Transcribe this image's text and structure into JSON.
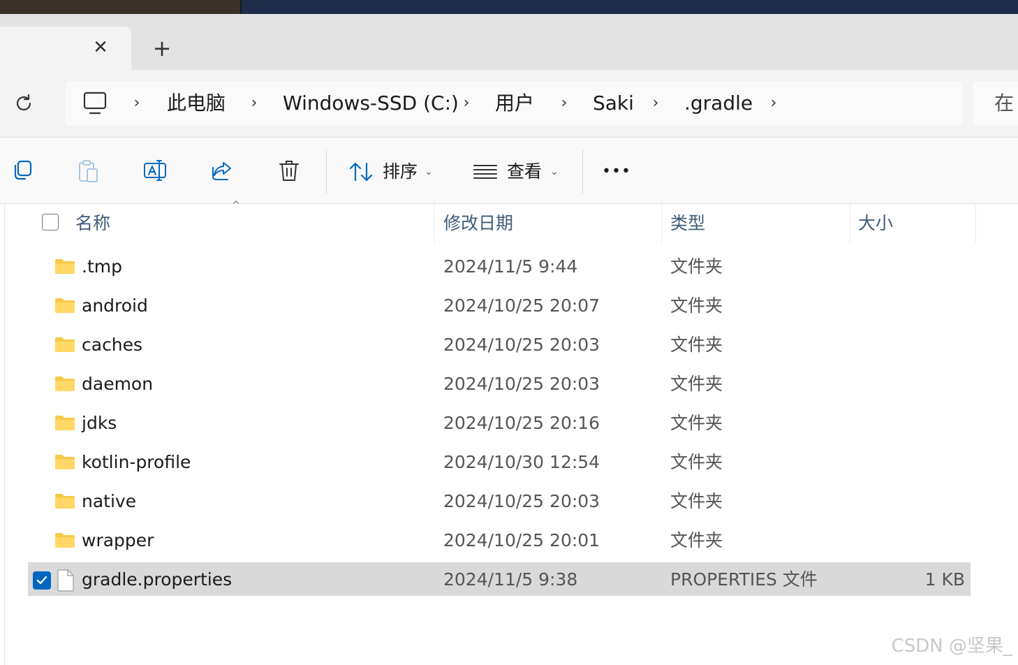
{
  "window": {
    "tab_close_glyph": "✕",
    "new_tab_glyph": "+"
  },
  "navbar": {
    "refresh_icon": "refresh-icon",
    "breadcrumb": [
      {
        "label": "此电脑"
      },
      {
        "label": "Windows-SSD (C:)"
      },
      {
        "label": "用户"
      },
      {
        "label": "Saki"
      },
      {
        "label": ".gradle"
      }
    ],
    "chevron": "›",
    "search_placeholder": "在"
  },
  "toolbar": {
    "sort_label": "排序",
    "view_label": "查看",
    "more_label": "•••",
    "caret": "⌄"
  },
  "file_list": {
    "columns": {
      "name": "名称",
      "modified": "修改日期",
      "type": "类型",
      "size": "大小"
    },
    "rows": [
      {
        "name": ".tmp",
        "modified": "2024/11/5 9:44",
        "type": "文件夹",
        "size": "",
        "kind": "folder"
      },
      {
        "name": "android",
        "modified": "2024/10/25 20:07",
        "type": "文件夹",
        "size": "",
        "kind": "folder"
      },
      {
        "name": "caches",
        "modified": "2024/10/25 20:03",
        "type": "文件夹",
        "size": "",
        "kind": "folder"
      },
      {
        "name": "daemon",
        "modified": "2024/10/25 20:03",
        "type": "文件夹",
        "size": "",
        "kind": "folder"
      },
      {
        "name": "jdks",
        "modified": "2024/10/25 20:16",
        "type": "文件夹",
        "size": "",
        "kind": "folder"
      },
      {
        "name": "kotlin-profile",
        "modified": "2024/10/30 12:54",
        "type": "文件夹",
        "size": "",
        "kind": "folder"
      },
      {
        "name": "native",
        "modified": "2024/10/25 20:03",
        "type": "文件夹",
        "size": "",
        "kind": "folder"
      },
      {
        "name": "wrapper",
        "modified": "2024/10/25 20:01",
        "type": "文件夹",
        "size": "",
        "kind": "folder"
      },
      {
        "name": "gradle.properties",
        "modified": "2024/11/5 9:38",
        "type": "PROPERTIES 文件",
        "size": "1 KB",
        "kind": "file",
        "selected": true
      }
    ]
  },
  "watermark": "CSDN @坚果_",
  "colors": {
    "accent": "#0067c0",
    "folder_yellow": "#f7c948",
    "selected_row": "#d9d9d9",
    "header_text": "#3f5b7a"
  }
}
